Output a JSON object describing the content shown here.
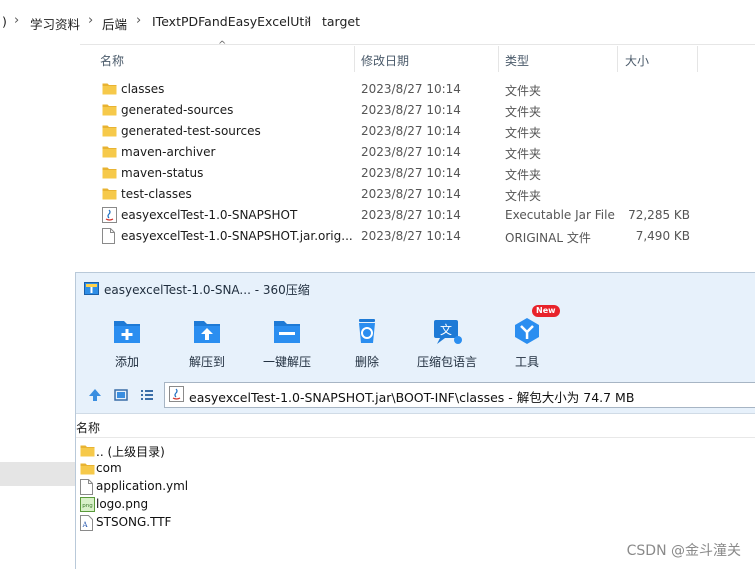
{
  "breadcrumb": {
    "lead": ")",
    "items": [
      "学习资料",
      "后端",
      "ITextPDFandEasyExcelUtil",
      "target"
    ],
    "separator": "›"
  },
  "explorer": {
    "columns": {
      "name": "名称",
      "date": "修改日期",
      "type": "类型",
      "size": "大小"
    },
    "rows": [
      {
        "name": "classes",
        "date": "2023/8/27 10:14",
        "type": "文件夹",
        "size": "",
        "icon": "folder-icon"
      },
      {
        "name": "generated-sources",
        "date": "2023/8/27 10:14",
        "type": "文件夹",
        "size": "",
        "icon": "folder-icon"
      },
      {
        "name": "generated-test-sources",
        "date": "2023/8/27 10:14",
        "type": "文件夹",
        "size": "",
        "icon": "folder-icon"
      },
      {
        "name": "maven-archiver",
        "date": "2023/8/27 10:14",
        "type": "文件夹",
        "size": "",
        "icon": "folder-icon"
      },
      {
        "name": "maven-status",
        "date": "2023/8/27 10:14",
        "type": "文件夹",
        "size": "",
        "icon": "folder-icon"
      },
      {
        "name": "test-classes",
        "date": "2023/8/27 10:14",
        "type": "文件夹",
        "size": "",
        "icon": "folder-icon"
      },
      {
        "name": "easyexcelTest-1.0-SNAPSHOT",
        "date": "2023/8/27 10:14",
        "type": "Executable Jar File",
        "size": "72,285 KB",
        "icon": "java-jar-icon"
      },
      {
        "name": "easyexcelTest-1.0-SNAPSHOT.jar.orig...",
        "date": "2023/8/27 10:14",
        "type": "ORIGINAL 文件",
        "size": "7,490 KB",
        "icon": "file-icon"
      }
    ]
  },
  "zip": {
    "title": "easyexcelTest-1.0-SNA... - 360压缩",
    "tools": [
      {
        "label": "添加",
        "icon": "add-icon"
      },
      {
        "label": "解压到",
        "icon": "extract-to-icon"
      },
      {
        "label": "一键解压",
        "icon": "one-click-extract-icon"
      },
      {
        "label": "删除",
        "icon": "delete-icon"
      },
      {
        "label": "压缩包语言",
        "icon": "language-icon"
      },
      {
        "label": "工具",
        "icon": "tools-icon",
        "badge": "New"
      }
    ],
    "path": "easyexcelTest-1.0-SNAPSHOT.jar\\BOOT-INF\\classes - 解包大小为 74.7 MB",
    "column_name": "名称",
    "files": [
      {
        "name": ".. (上级目录)",
        "icon": "folder-icon"
      },
      {
        "name": "com",
        "icon": "folder-icon"
      },
      {
        "name": "application.yml",
        "icon": "file-icon"
      },
      {
        "name": "logo.png",
        "icon": "png-icon"
      },
      {
        "name": "STSONG.TTF",
        "icon": "font-file-icon"
      }
    ]
  },
  "watermark": "CSDN @金斗潼关",
  "colors": {
    "folder": "#f6c94a",
    "accent": "#1e7ad6",
    "toolbar_bg": "#e7f1fb",
    "badge": "#e8232b"
  }
}
